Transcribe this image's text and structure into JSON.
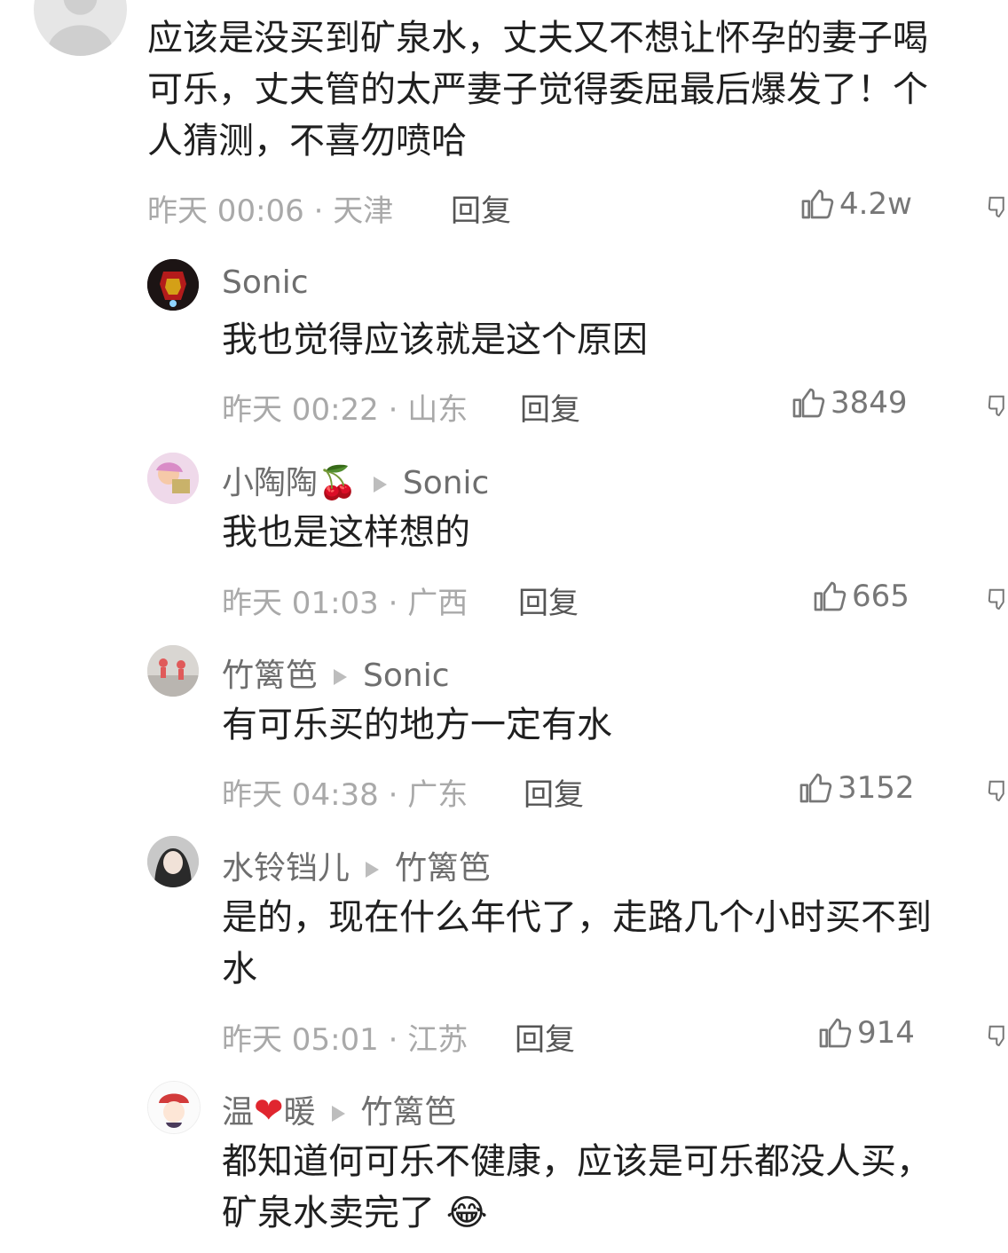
{
  "top_comment": {
    "lines": [
      "应该是没买到矿泉水，丈夫又不想让怀孕的妻子喝",
      "可乐，丈夫管的太严妻子觉得委屈最后爆发了！个",
      "人猜测，不喜勿喷哈"
    ],
    "meta": "昨天 00:06 · 天津",
    "reply_label": "回复",
    "likes": "4.2w"
  },
  "replies": [
    {
      "name": "Sonic",
      "emoji": "",
      "target": "",
      "lines": [
        "我也觉得应该就是这个原因"
      ],
      "meta": "昨天 00:22 · 山东",
      "reply_label": "回复",
      "likes": "3849"
    },
    {
      "name": "小陶陶",
      "emoji": "🍒",
      "target": "Sonic",
      "lines": [
        "我也是这样想的"
      ],
      "meta": "昨天 01:03 · 广西",
      "reply_label": "回复",
      "likes": "665"
    },
    {
      "name": "竹篱笆",
      "emoji": "",
      "target": "Sonic",
      "lines": [
        "有可乐买的地方一定有水"
      ],
      "meta": "昨天 04:38 · 广东",
      "reply_label": "回复",
      "likes": "3152"
    },
    {
      "name": "水铃铛儿",
      "emoji": "",
      "target": "竹篱笆",
      "lines": [
        "是的，现在什么年代了，走路几个小时买不到",
        "水"
      ],
      "meta": "昨天 05:01 · 江苏",
      "reply_label": "回复",
      "likes": "914"
    },
    {
      "name_a": "温",
      "name_b": "暖",
      "emoji": "❤",
      "target": "竹篱笆",
      "lines": [
        "都知道何可乐不健康，应该是可乐都没人买，",
        "矿泉水卖完了"
      ],
      "end_emoji": "😂"
    }
  ],
  "icons": {
    "like": "thumbs-up-icon",
    "edge": "thumbs-down-icon-partial",
    "arrow": "reply-to-arrow-icon"
  }
}
